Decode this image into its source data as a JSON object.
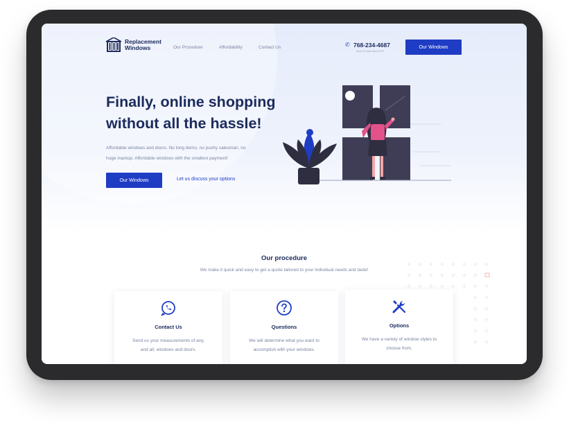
{
  "header": {
    "logo_line1": "Replacement",
    "logo_line2": "Windows",
    "nav": [
      "Our Procedure",
      "Affordability",
      "Contact Us"
    ],
    "phone_number": "768-234-4687",
    "phone_hours": "Mon-Fri 9am-5pm EST",
    "phone_icon": "phone-icon",
    "cta_label": "Our Windows"
  },
  "hero": {
    "title_line1": "Finally, online shopping",
    "title_line2": "without all the hassle!",
    "description_line1": "Affordable windows and doors. No long demo, no pushy salesman, no",
    "description_line2": "huge markup. Affordable windows with the smallest payment!",
    "primary_button": "Our Windows",
    "secondary_link": "Let us discuss your options"
  },
  "procedure": {
    "title": "Our procedure",
    "subtitle": "We make it quick and easy to get a quote tailored to your individual needs and taste!",
    "cards": [
      {
        "icon": "whatsapp-icon",
        "title": "Contact Us",
        "line1": "Send us your measurements of any,",
        "line2": "and all, windows and doors."
      },
      {
        "icon": "question-icon",
        "title": "Questions",
        "line1": "We will determine what you want to",
        "line2": "accomplish with your windows."
      },
      {
        "icon": "tools-icon",
        "title": "Options",
        "line1": "We have a variety of window styles to",
        "line2": "choose from."
      }
    ]
  },
  "colors": {
    "accent": "#1f3cc4",
    "heading": "#1b2a5c",
    "body_text": "#7a84a3",
    "device_frame": "#2b2b2d"
  }
}
